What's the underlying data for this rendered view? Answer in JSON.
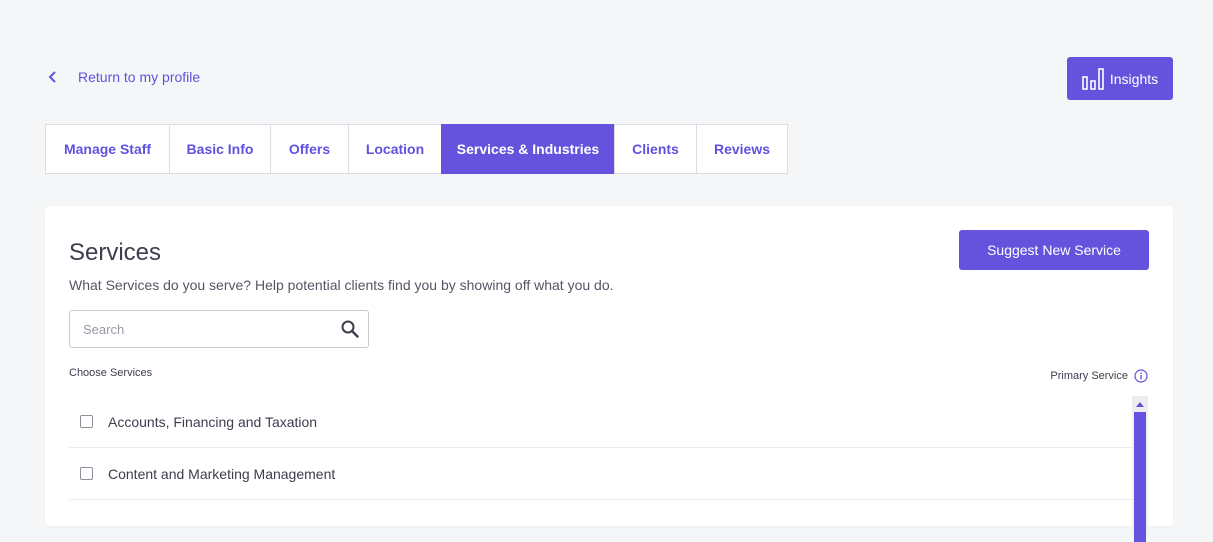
{
  "back_link": {
    "label": "Return to my profile",
    "icon": "chevron-left-icon"
  },
  "insights": {
    "label": "Insights",
    "icon": "bar-chart-icon"
  },
  "tabs": [
    {
      "label": "Manage Staff",
      "active": false
    },
    {
      "label": "Basic Info",
      "active": false
    },
    {
      "label": "Offers",
      "active": false
    },
    {
      "label": "Location",
      "active": false
    },
    {
      "label": "Services & Industries",
      "active": true
    },
    {
      "label": "Clients",
      "active": false
    },
    {
      "label": "Reviews",
      "active": false
    }
  ],
  "services": {
    "title": "Services",
    "subtitle": "What Services do you serve? Help potential clients find you by showing off what you do.",
    "suggest_label": "Suggest New Service",
    "search_placeholder": "Search",
    "choose_label": "Choose Services",
    "primary_label": "Primary Service",
    "items": [
      {
        "label": "Accounts, Financing and Taxation",
        "checked": false
      },
      {
        "label": "Content and Marketing Management",
        "checked": false
      }
    ]
  },
  "colors": {
    "accent": "#6553de",
    "background": "#f5f6f8",
    "text": "#3d3d4e"
  }
}
